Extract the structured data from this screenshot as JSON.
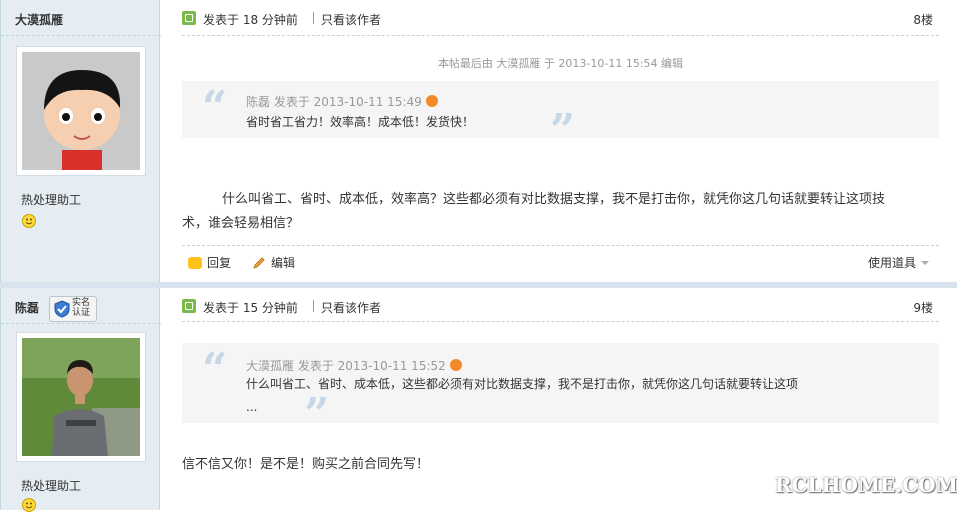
{
  "posts": [
    {
      "author": "大漠孤雁",
      "rank": "热处理助工",
      "posted": "发表于 18 分钟前",
      "only_author": "只看该作者",
      "floor": "8楼",
      "edit_note": "本帖最后由 大漠孤雁 于 2013-10-11 15:54 编辑",
      "quote": {
        "author_time": "陈磊 发表于 2013-10-11 15:49",
        "text": "省时省工省力！效率高！成本低！发货快！"
      },
      "message_line1": "什么叫省工、省时、成本低，效率高？这些都必须有对比数据支撑，我不是打击你，就凭你这几句话就要转让这项技",
      "message_line2": "术，谁会轻易相信？",
      "actions": {
        "reply": "回复",
        "edit": "编辑",
        "tools": "使用道具"
      }
    },
    {
      "author": "陈磊",
      "badge": "实名认证",
      "rank": "热处理助工",
      "posted": "发表于 15 分钟前",
      "only_author": "只看该作者",
      "floor": "9楼",
      "quote": {
        "author_time": "大漠孤雁 发表于 2013-10-11 15:52",
        "text": "什么叫省工、省时、成本低，这些都必须有对比数据支撑，我不是打击你，就凭你这几句话就要转让这项",
        "ellipsis": "..."
      },
      "message": "信不信又你！是不是！购买之前合同先写！"
    }
  ],
  "watermark": "RCLHOME.COM",
  "colors": {
    "sidebar_bg": "#e5edf2",
    "quote_bg": "#f5f5f5",
    "accent_green": "#7ab94a",
    "accent_orange": "#f58b28"
  }
}
